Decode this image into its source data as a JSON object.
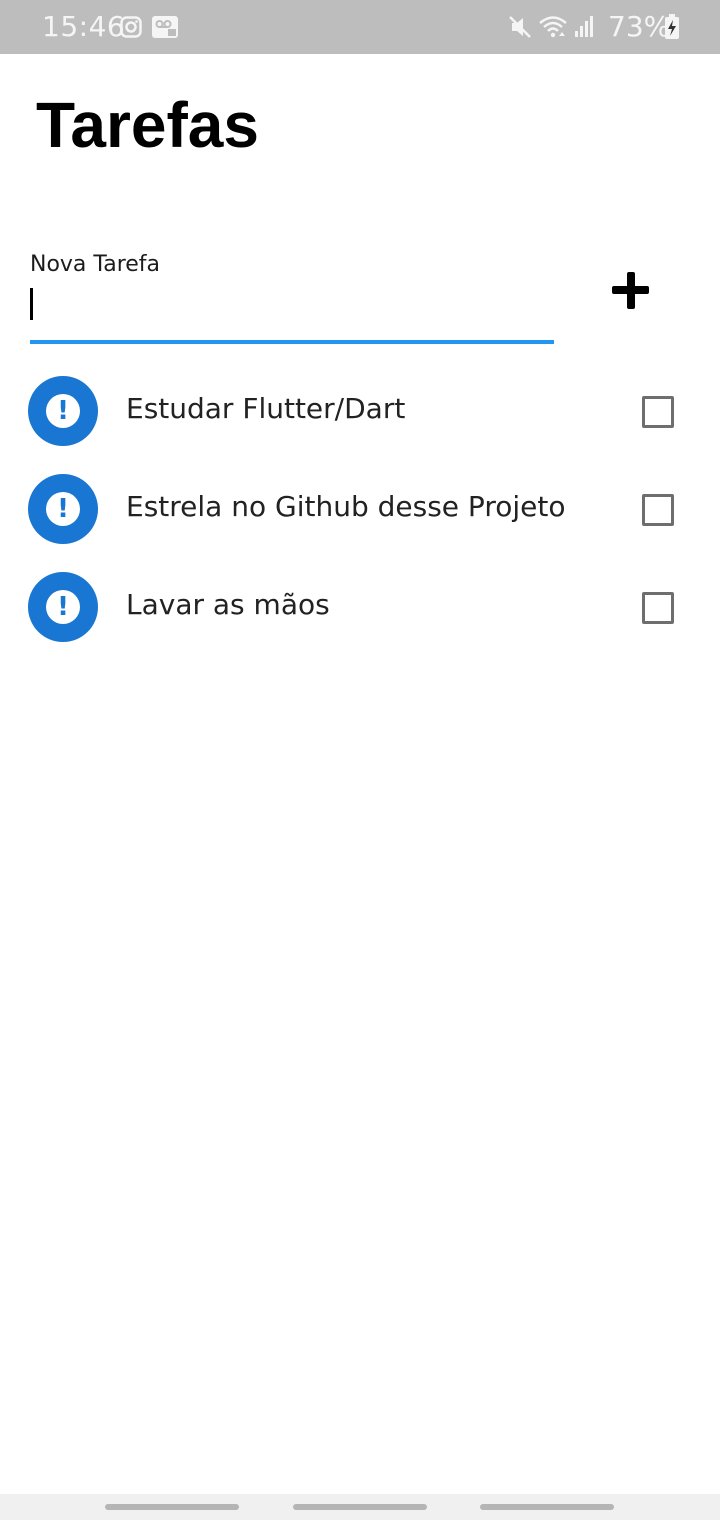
{
  "status_bar": {
    "time": "15:46",
    "battery": "73%",
    "icons": [
      "instagram-icon",
      "voicemail-icon",
      "mute-icon",
      "wifi-icon",
      "signal-icon",
      "battery-charging-icon"
    ]
  },
  "header": {
    "title": "Tarefas"
  },
  "new_task": {
    "label": "Nova Tarefa",
    "value": "",
    "add_icon": "plus-icon"
  },
  "tasks": [
    {
      "label": "Estudar Flutter/Dart",
      "checked": false,
      "icon": "alert-icon"
    },
    {
      "label": "Estrela no Github desse Projeto",
      "checked": false,
      "icon": "alert-icon"
    },
    {
      "label": "Lavar as mãos",
      "checked": false,
      "icon": "alert-icon"
    }
  ],
  "colors": {
    "accent": "#2196f3",
    "avatar": "#1976d2",
    "status_bar": "#bdbdbd"
  }
}
